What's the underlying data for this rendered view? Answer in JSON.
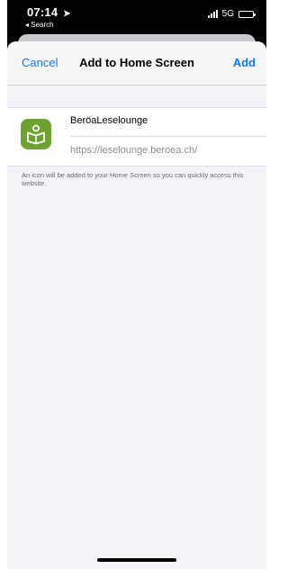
{
  "status_bar": {
    "time": "07:14",
    "location_arrow": "➤",
    "back_app": "◂ Search",
    "network": "5G"
  },
  "nav": {
    "cancel_label": "Cancel",
    "title": "Add to Home Screen",
    "add_label": "Add"
  },
  "bookmark": {
    "name": "BeröaLeselounge",
    "url": "https://leselounge.beroea.ch/",
    "icon": "book-reader-icon"
  },
  "info_text": "An icon will be added to your Home Screen so you can quickly access this website.",
  "colors": {
    "accent": "#0a7aff",
    "icon_bg": "#6ea332",
    "sheet_bg": "#f2f2f7"
  }
}
